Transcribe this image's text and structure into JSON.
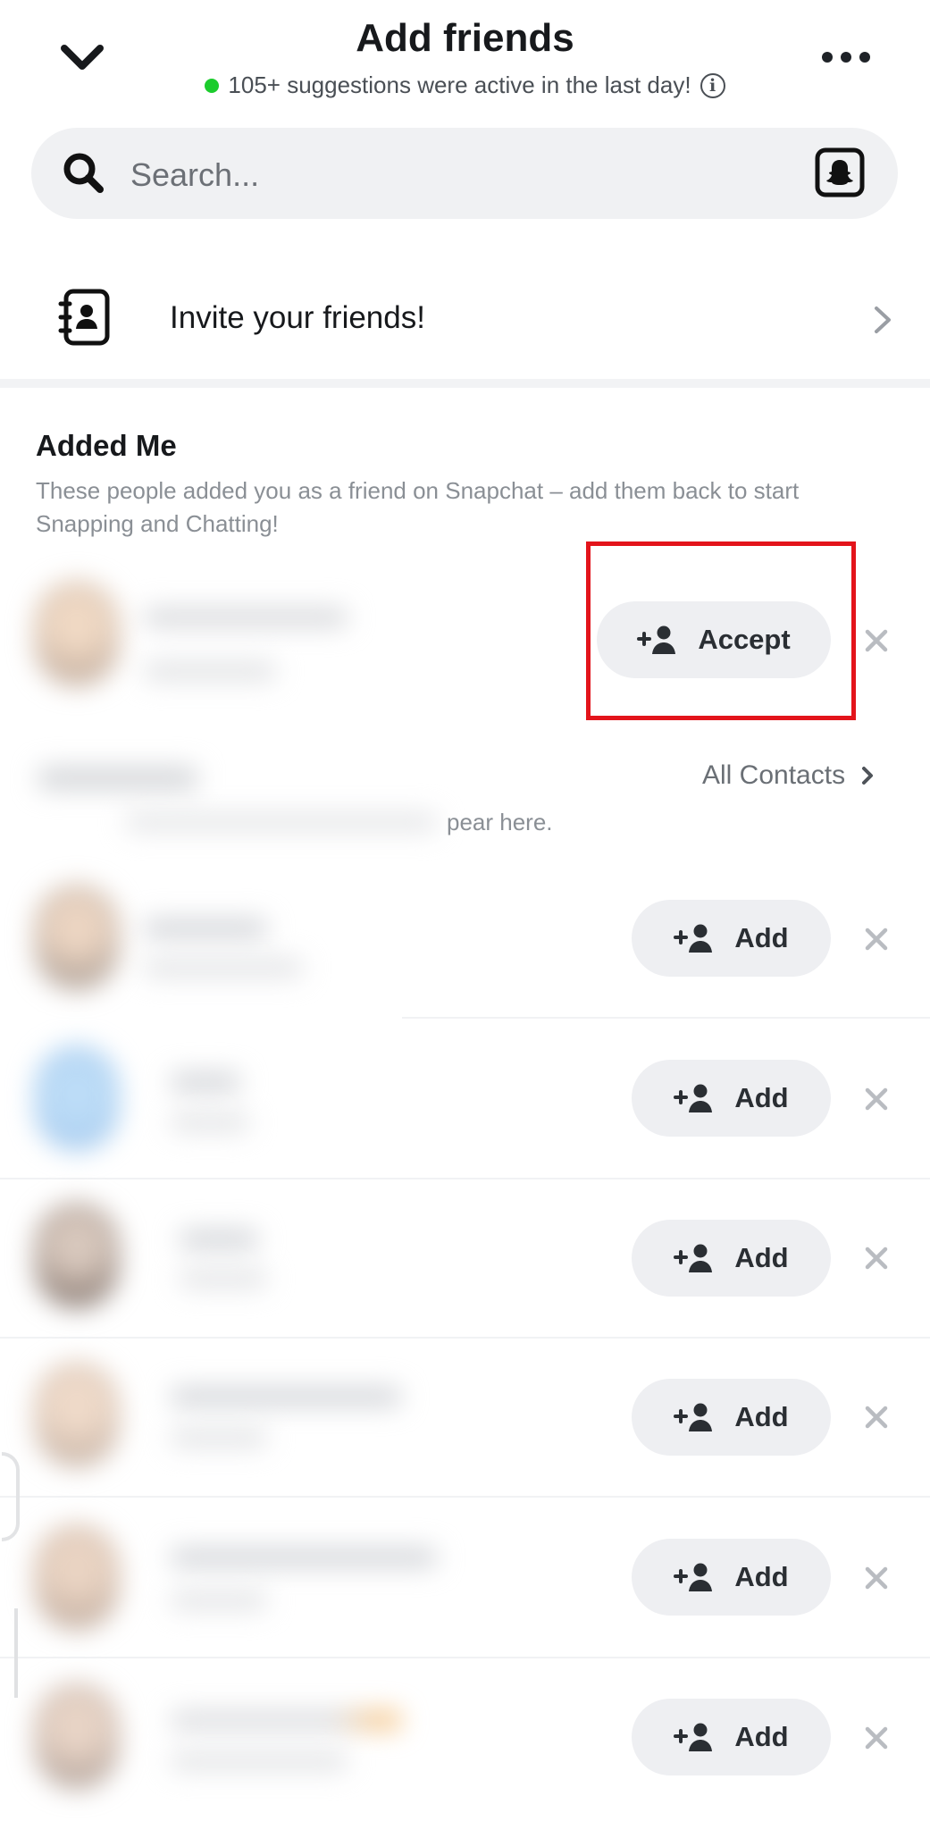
{
  "header": {
    "title": "Add friends",
    "subtitle": "105+ suggestions were active in the last day!",
    "status_color": "#1ccc2d"
  },
  "search": {
    "placeholder": "Search..."
  },
  "invite": {
    "label": "Invite your friends!"
  },
  "added_me": {
    "title": "Added Me",
    "description": "These people added you as a friend on Snapchat – add them back to start Snapping and Chatting!",
    "accept_label": "Accept"
  },
  "contacts": {
    "link_label": "All Contacts",
    "desc_fragment": "pear here."
  },
  "suggestions": [
    {
      "add_label": "Add"
    },
    {
      "add_label": "Add"
    },
    {
      "add_label": "Add"
    },
    {
      "add_label": "Add"
    },
    {
      "add_label": "Add"
    },
    {
      "add_label": "Add"
    }
  ],
  "colors": {
    "accent": "#1ccc2d",
    "highlight": "#e3141b",
    "pill_bg": "#eeeff2"
  }
}
